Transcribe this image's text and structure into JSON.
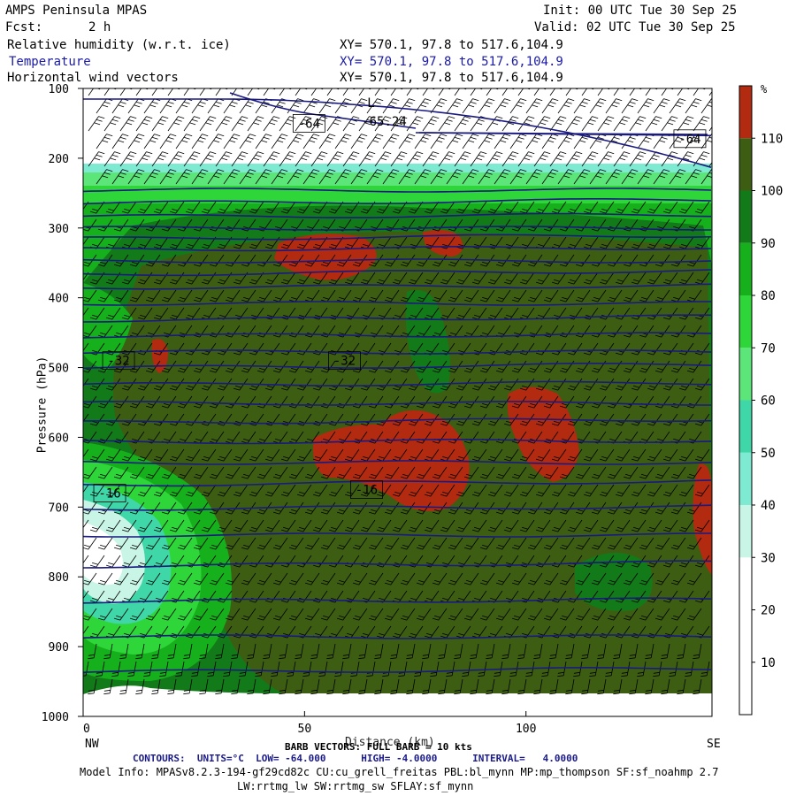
{
  "header": {
    "title": "AMPS Peninsula MPAS",
    "fcst_label": "Fcst:",
    "fcst_value": "2 h",
    "init": "Init: 00 UTC Tue 30 Sep 25",
    "valid": "Valid: 02 UTC Tue 30 Sep 25",
    "fields": [
      {
        "name": "Relative humidity (w.r.t. ice)",
        "xy": "XY= 570.1, 97.8 to 517.6,104.9"
      },
      {
        "name": "Temperature",
        "xy": "XY= 570.1, 97.8 to 517.6,104.9"
      },
      {
        "name": "Horizontal wind vectors",
        "xy": "XY= 570.1, 97.8 to 517.6,104.9"
      }
    ]
  },
  "footer": {
    "barb_note": "BARB VECTORS: FULL BARB = 10 kts",
    "xlabel_overlap": "Distance (km)",
    "contours": "CONTOURS:  UNITS=°C  LOW= -64.000      HIGH= -4.0000      INTERVAL=   4.0000",
    "model_info": "Model Info: MPASv8.2.3-194-gf29cd82c CU:cu_grell_freitas PBL:bl_mynn MP:mp_thompson SF:sf_noahmp 2.7",
    "model_info2": "LW:rrtmg_lw SW:rrtmg_sw SFLAY:sf_mynn"
  },
  "chart_data": {
    "type": "heatmap",
    "title": "Relative humidity (w.r.t. ice)",
    "xlabel": "",
    "ylabel": "Pressure (hPa)",
    "x_ticks": [
      0,
      50,
      100
    ],
    "x_end_labels": {
      "left": "NW",
      "right": "SE"
    },
    "xlim": [
      0,
      142
    ],
    "y_ticks": [
      100,
      200,
      300,
      400,
      500,
      600,
      700,
      800,
      900,
      1000
    ],
    "ylim": [
      1000,
      100
    ],
    "colorbar": {
      "unit": "%",
      "ticks": [
        10,
        20,
        30,
        40,
        50,
        60,
        70,
        80,
        90,
        100,
        110
      ],
      "bins": [
        {
          "range": [
            0,
            10
          ],
          "color": "#ffffff"
        },
        {
          "range": [
            10,
            20
          ],
          "color": "#ffffff"
        },
        {
          "range": [
            20,
            30
          ],
          "color": "#ffffff"
        },
        {
          "range": [
            30,
            40
          ],
          "color": "#c8f5e6"
        },
        {
          "range": [
            40,
            50
          ],
          "color": "#7eead2"
        },
        {
          "range": [
            50,
            60
          ],
          "color": "#3fd6a8"
        },
        {
          "range": [
            60,
            70
          ],
          "color": "#5ce67a"
        },
        {
          "range": [
            70,
            80
          ],
          "color": "#2ed63a"
        },
        {
          "range": [
            80,
            90
          ],
          "color": "#16b01c"
        },
        {
          "range": [
            90,
            100
          ],
          "color": "#137a1a"
        },
        {
          "range": [
            100,
            110
          ],
          "color": "#3d5e12"
        },
        {
          "range": [
            110,
            120
          ],
          "color": "#b22a10"
        }
      ]
    },
    "temperature_contours": {
      "units": "°C",
      "low": -64.0,
      "high": -4.0,
      "interval": 4.0,
      "labels": [
        {
          "value": "-64",
          "x": 51,
          "p": 150
        },
        {
          "value": "-64",
          "x": 137,
          "p": 172
        },
        {
          "value": "-32",
          "x": 8,
          "p": 490
        },
        {
          "value": "-32",
          "x": 59,
          "p": 490
        },
        {
          "value": "-16",
          "x": 6,
          "p": 680
        },
        {
          "value": "-16",
          "x": 64,
          "p": 675
        }
      ],
      "extreme_labels": [
        {
          "value": "L",
          "x": 65,
          "p": 120
        },
        {
          "value": "-65.24",
          "x": 68,
          "p": 147
        }
      ]
    },
    "wind": "Horizontal wind vectors (barbs)"
  }
}
